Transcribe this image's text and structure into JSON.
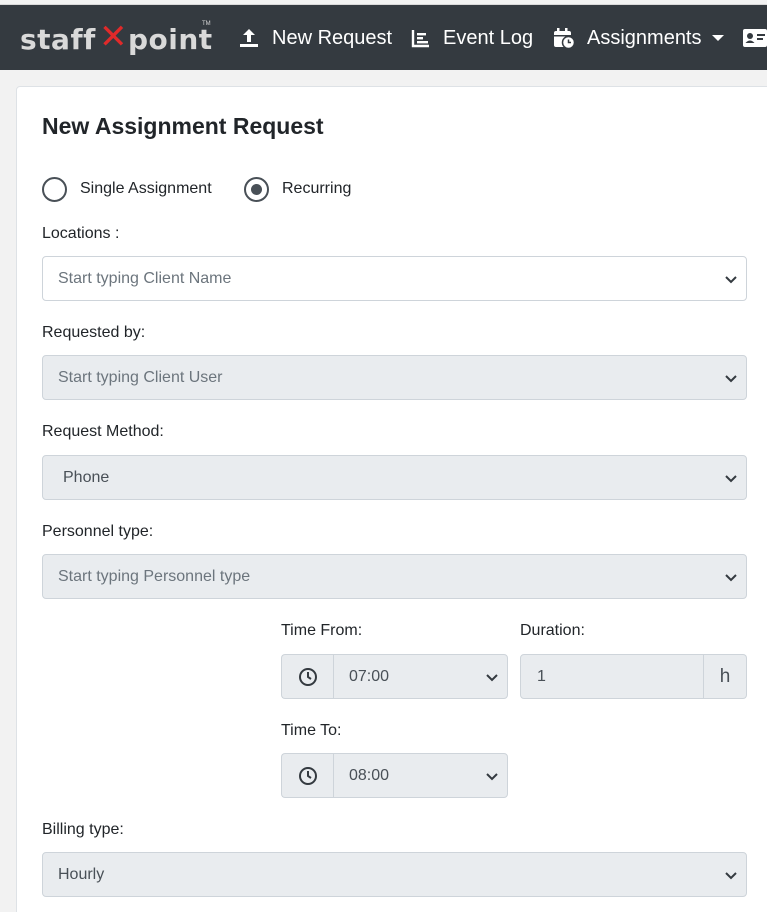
{
  "nav": {
    "logo": {
      "part1": "staff",
      "part2": "point",
      "tm": "TM"
    },
    "items": [
      {
        "label": "New Request",
        "icon": "upload-icon"
      },
      {
        "label": "Event Log",
        "icon": "chart-icon"
      },
      {
        "label": "Assignments",
        "icon": "calendar-clock-icon"
      }
    ]
  },
  "form": {
    "title": "New Assignment Request",
    "assignment_type": {
      "options": [
        "Single Assignment",
        "Recurring"
      ],
      "selected": "Recurring"
    },
    "locations": {
      "label": "Locations :",
      "placeholder": "Start typing Client Name"
    },
    "requested_by": {
      "label": "Requested by:",
      "placeholder": "Start typing Client User"
    },
    "request_method": {
      "label": "Request Method:",
      "value": "Phone"
    },
    "personnel_type": {
      "label": "Personnel type:",
      "placeholder": "Start typing Personnel type"
    },
    "time_from": {
      "label": "Time From:",
      "value": "07:00"
    },
    "duration": {
      "label": "Duration:",
      "value": "1",
      "unit": "h"
    },
    "time_to": {
      "label": "Time To:",
      "value": "08:00"
    },
    "billing_type": {
      "label": "Billing type:",
      "value": "Hourly"
    }
  },
  "colors": {
    "navbar": "#343a40",
    "accent": "#e02a2a",
    "disabled": "#e9ecef"
  }
}
